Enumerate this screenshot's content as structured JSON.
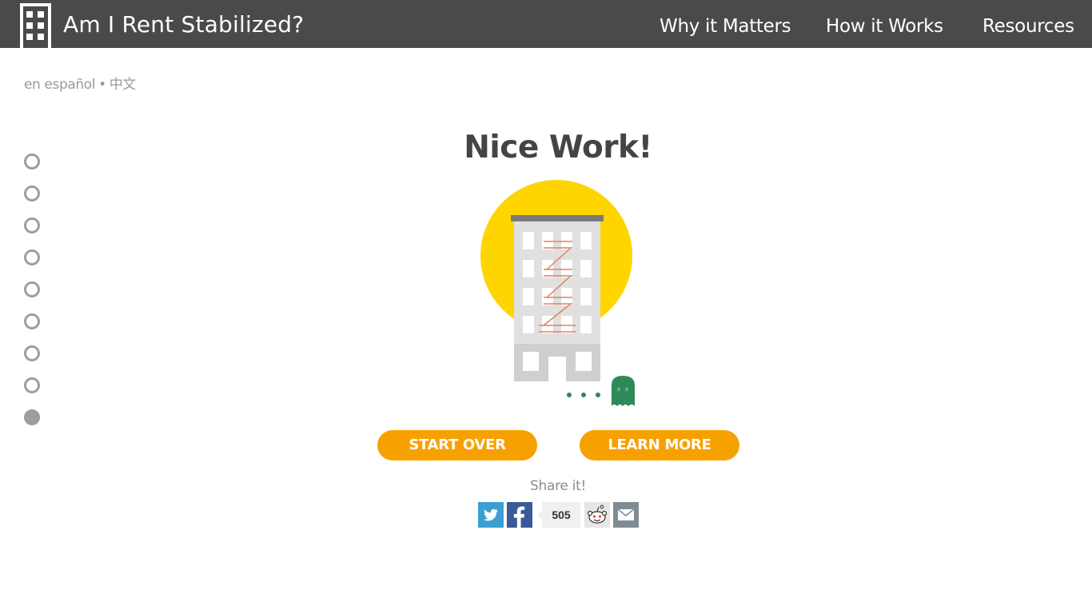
{
  "header": {
    "logo_icon": "building-icon",
    "title": "Am I Rent Stabilized?",
    "nav": [
      "Why it Matters",
      "How it Works",
      "Resources"
    ],
    "background": "#4a4a4a"
  },
  "languages": {
    "spanish": "en español",
    "separator": "•",
    "chinese": "中文"
  },
  "progress": {
    "total_steps": 9,
    "current_step": 9,
    "color": "#9e9e9e"
  },
  "main": {
    "headline": "Nice Work!",
    "illustration_icons": [
      "sun-icon",
      "apartment-building-icon",
      "ghost-icon"
    ],
    "buttons": {
      "start_over": "START OVER",
      "learn_more": "LEARN MORE"
    },
    "button_color": "#f7a100",
    "accent_yellow": "#ffd500"
  },
  "share": {
    "label": "Share it!",
    "icons": [
      "twitter-icon",
      "facebook-icon",
      "reddit-icon",
      "email-icon"
    ],
    "facebook_count": "505",
    "colors": {
      "twitter": "#3b9fd1",
      "facebook": "#3b5998",
      "email": "#7f8c93"
    }
  }
}
